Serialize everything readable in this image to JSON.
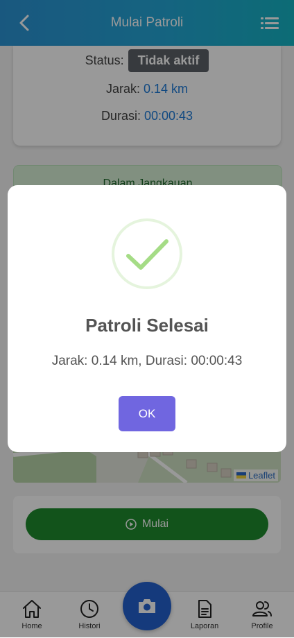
{
  "header": {
    "title": "Mulai Patroli"
  },
  "status": {
    "status_label": "Status:",
    "status_value": "Tidak aktif",
    "distance_label": "Jarak:",
    "distance_value": "0.14 km",
    "duration_label": "Durasi:",
    "duration_value": "00:00:43"
  },
  "range": {
    "text": "Dalam Jangkauan"
  },
  "map": {
    "attribution": "Leaflet"
  },
  "start": {
    "label": "Mulai"
  },
  "nav": {
    "home": "Home",
    "histori": "Histori",
    "laporan": "Laporan",
    "profile": "Profile"
  },
  "modal": {
    "title": "Patroli Selesai",
    "text": "Jarak: 0.14 km, Durasi: 00:00:43",
    "ok_label": "OK"
  },
  "colors": {
    "header_start": "#2b93d4",
    "header_end": "#15b4c4",
    "accent_blue": "#1d7bd8",
    "start_green": "#1e8a2e",
    "ok_purple": "#7066e0",
    "check_green": "#a5dc86"
  }
}
